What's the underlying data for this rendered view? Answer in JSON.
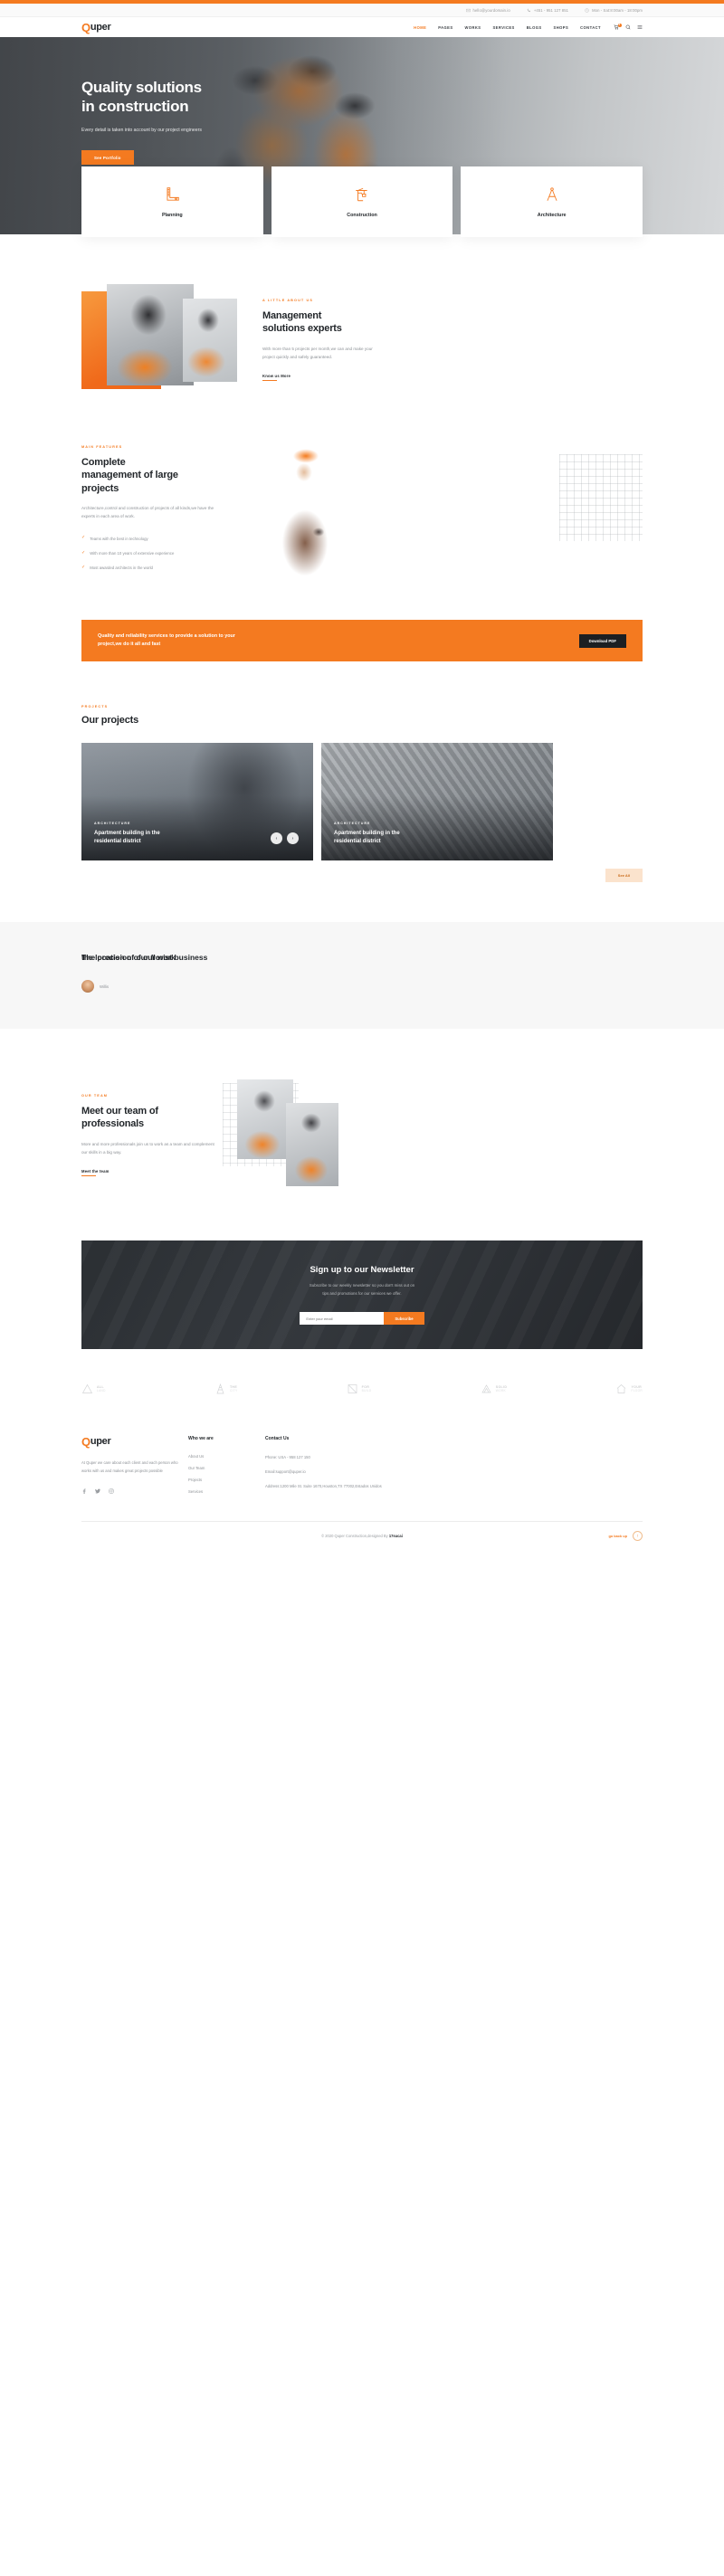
{
  "topbar": {
    "email": "hello@yourdomain.io",
    "phone": "+451 - 951 127 851",
    "hours": "Mon - Sat:8:00am - 18:00pm"
  },
  "brand": {
    "first": "Q",
    "rest": "uper"
  },
  "nav": {
    "items": [
      {
        "label": "HOME",
        "active": true
      },
      {
        "label": "PAGES",
        "active": false
      },
      {
        "label": "WORKS",
        "active": false
      },
      {
        "label": "SERVICES",
        "active": false
      },
      {
        "label": "BLOGS",
        "active": false
      },
      {
        "label": "SHOPS",
        "active": false
      },
      {
        "label": "CONTACT",
        "active": false
      }
    ],
    "cart_count": "2"
  },
  "hero": {
    "title_line1": "Quality solutions",
    "title_line2": "in construction",
    "subtitle": "Every detail is taken into account by our project engineers",
    "cta": "See Portfolio"
  },
  "cards": [
    {
      "title": "Planning",
      "icon": "ruler-square-icon"
    },
    {
      "title": "Construction",
      "icon": "crane-icon"
    },
    {
      "title": "Architecture",
      "icon": "compass-icon"
    }
  ],
  "about": {
    "eyebrow": "A LITTLE ABOUT US",
    "title_line1": "Management",
    "title_line2": "solutions experts",
    "body": "With more than 5 projects per month,we can and make your project quickly and safely guaranteed.",
    "link": "Know us More"
  },
  "features": {
    "eyebrow": "MAIN FEATURES",
    "title_line1": "Complete",
    "title_line2": "management of large",
    "title_line3": "projects",
    "body": "Architecture,control and construction of projects of all kinds,we have the experts in each area of work.",
    "items": [
      "Teams with the best in technology",
      "With more than 10 years of extensive experience",
      "Most awarded architects in the world"
    ]
  },
  "banner": {
    "text": "Quality and reliability services to provide a solution to your project,we do it all and fast",
    "button": "Download PDF"
  },
  "projects": {
    "eyebrow": "PROJECTS",
    "title": "Our projects",
    "items": [
      {
        "category": "ARCHITECTURE",
        "name_line1": "Apartment building in the",
        "name_line2": "residential district"
      },
      {
        "category": "ARCHITECTURE",
        "name_line1": "Apartment building in the",
        "name_line2": "residential district"
      }
    ],
    "prev": "‹",
    "next": "›",
    "see_all": "See All"
  },
  "testimonial": {
    "quote_top": "the location of our florist business",
    "quote_bottom": "The precision of our work",
    "author": "Willis"
  },
  "team": {
    "eyebrow": "OUR TEAM",
    "title_line1": "Meet our team of",
    "title_line2": "professionals",
    "body": "More and more professionals join us to work as a team and complement our skills in a big way.",
    "link": "Meet the team"
  },
  "newsletter": {
    "title": "Sign up to our Newsletter",
    "subtitle_line1": "Subscribe to our weekly newsletter so you don't miss out on",
    "subtitle_line2": "tips and promotions for our services we offer.",
    "placeholder": "Enter your email",
    "button": "Subscribe"
  },
  "clients": [
    {
      "name1": "ALL",
      "name2": "LAND",
      "icon": "triangle-logo-icon"
    },
    {
      "name1": "THE",
      "name2": "CITY",
      "icon": "tower-logo-icon"
    },
    {
      "name1": "FOR",
      "name2": "BUILD",
      "icon": "square-logo-icon"
    },
    {
      "name1": "SOLID",
      "name2": "WORK",
      "icon": "arrow-logo-icon"
    },
    {
      "name1": "YOUR",
      "name2": "FLOOR",
      "icon": "home-logo-icon"
    }
  ],
  "footer": {
    "brand_first": "Q",
    "brand_rest": "uper",
    "description": "At Quper we care about each client and each person who works with us and makes great projects possible",
    "social": [
      "facebook-icon",
      "twitter-icon",
      "instagram-icon"
    ],
    "who_heading": "Who we are",
    "who_links": [
      "About Us",
      "Our Team",
      "Projects",
      "Services"
    ],
    "contact_heading": "Contact Us",
    "contact": [
      "Phone: USA - 958 127 150",
      "Email:support@quper.io",
      "Address:1200 Mile St. Suite 1670,Houston,TX 77002,Estados Unidos"
    ],
    "copyright_pre": "© 2020 Quper Construction,designed By ",
    "copyright_brand": "17sucai",
    "gotop_label": "go back up",
    "gotop_icon": "↑"
  }
}
